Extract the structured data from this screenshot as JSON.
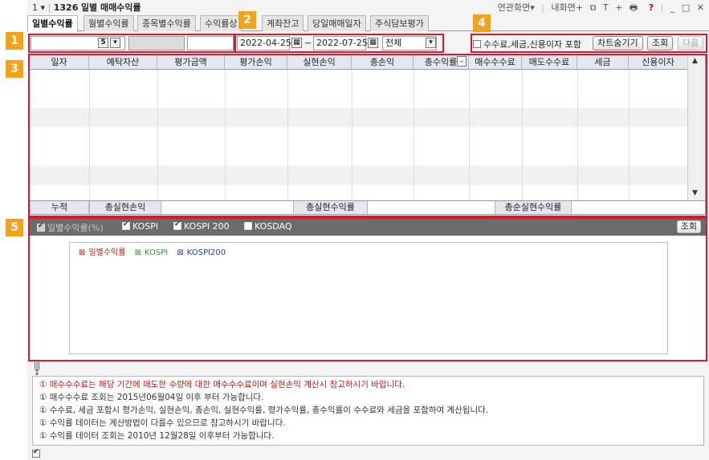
{
  "titlebar": {
    "menu_num": "1",
    "menu_arrow": "▾",
    "screen_code": "1326",
    "screen_title": "일별 매매수익률",
    "right_linked": "연관화면▾",
    "right_myscreen": "내화면+",
    "right_icons": [
      "⧉",
      "T",
      "+",
      "🖶"
    ],
    "right_help": "?",
    "win_min": "_",
    "win_max": "□",
    "win_close": "✕"
  },
  "tabs": [
    "일별수익률",
    "월별수익률",
    "종목별수익률",
    "수익률상",
    "계좌잔고",
    "당일매매일자",
    "주식담보평가"
  ],
  "callouts": [
    "1",
    "2",
    "3",
    "4",
    "5"
  ],
  "toolbar": {
    "account_suffix": "5",
    "dropdown_arrow": "▾",
    "start_date": "2022-04-25",
    "tilde": "~",
    "end_date": "2022-07-25",
    "calendar_icon": "▦",
    "scope": "전체",
    "include_fee_label": "수수료,세금,신용이자 포함",
    "chart_hide_btn": "차트숨기기",
    "search_btn": "조회",
    "next_btn": "다음"
  },
  "grid": {
    "columns": [
      "일자",
      "예탁자산",
      "평가금액",
      "평가손익",
      "실현손익",
      "총손익",
      "총수익률",
      "매수수수료",
      "매도수수료",
      "세금",
      "신용이자"
    ],
    "sort_icon": "⌄",
    "footer": {
      "cumulative": "누적",
      "total_realized_pl": "총실현손익",
      "total_realized_rate": "총실현수익률",
      "total_net_realized_rate": "총순실현수익률"
    },
    "scroll_up": "▲",
    "scroll_down": "▼"
  },
  "chart_options": {
    "daily_rate": "일별수익률(%)",
    "kospi": "KOSPI",
    "kospi200": "KOSPI 200",
    "kosdaq": "KOSDAQ",
    "search_btn": "조회"
  },
  "chart_legend": {
    "daily_rate": "일별수익률",
    "kospi": "KOSPI",
    "kospi200": "KOSPI200",
    "marker": "⊠"
  },
  "resize_icon": "↕",
  "notes": [
    "① 매수수수료는 해당 기간에 매도한 수량에 대한 매수수수료이며 실현손익 계산시 참고하시기 바랍니다.",
    "① 매수수수료 조회는 2015년06월04일 이후 부터 가능합니다.",
    "① 수수료, 세금 포함시 평가손익, 실현손익, 총손익, 실현수익률, 평가수익률, 총수익률이 수수료와 세금을 포함하여 계산됩니다.",
    "① 수익률 데이터는 계산방법이 다를수 있으므로 참고하시기 바랍니다.",
    "① 수익률 데이터 조회는 2010년 12월28일 이후부터 가능합니다."
  ],
  "colors": {
    "callout": "#f5a21b",
    "highlight_border": "#d7192c",
    "legend_daily": "#c81e1e",
    "legend_kospi": "#2e9a2e",
    "legend_kospi200": "#1d3fb8"
  }
}
